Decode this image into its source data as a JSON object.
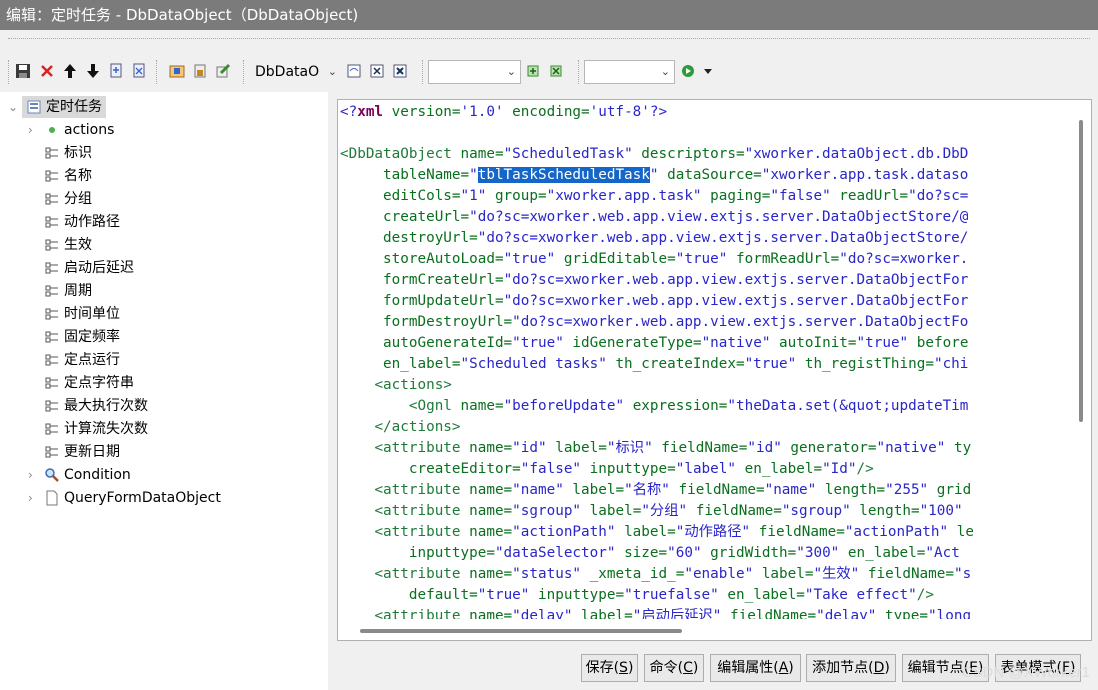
{
  "window": {
    "title": "编辑：定时任务 - DbDataObject（DbDataObject)"
  },
  "toolbar": {
    "combo1_value": "DbDataO",
    "combo2_value": "",
    "combo3_value": "",
    "icons": [
      "save-icon",
      "delete-icon",
      "move-up-icon",
      "move-down-icon",
      "export-icon",
      "import-icon",
      "open-icon",
      "lock-icon",
      "edit-icon",
      "doc-icon",
      "close-doc-icon",
      "close-all-icon",
      "add-icon",
      "remove-icon",
      "run-icon",
      "dropdown-icon"
    ]
  },
  "tree": {
    "root": {
      "label": "定时任务",
      "icon": "dataobject-icon"
    },
    "items": [
      {
        "label": "actions",
        "icon": "dot-icon",
        "expandable": true
      },
      {
        "label": "标识",
        "icon": "attribute-icon"
      },
      {
        "label": "名称",
        "icon": "attribute-icon"
      },
      {
        "label": "分组",
        "icon": "attribute-icon"
      },
      {
        "label": "动作路径",
        "icon": "attribute-icon"
      },
      {
        "label": "生效",
        "icon": "attribute-icon"
      },
      {
        "label": "启动后延迟",
        "icon": "attribute-icon"
      },
      {
        "label": "周期",
        "icon": "attribute-icon"
      },
      {
        "label": "时间单位",
        "icon": "attribute-icon"
      },
      {
        "label": "固定频率",
        "icon": "attribute-icon"
      },
      {
        "label": "定点运行",
        "icon": "attribute-icon"
      },
      {
        "label": "定点字符串",
        "icon": "attribute-icon"
      },
      {
        "label": "最大执行次数",
        "icon": "attribute-icon"
      },
      {
        "label": "计算流失次数",
        "icon": "attribute-icon"
      },
      {
        "label": "更新日期",
        "icon": "attribute-icon"
      },
      {
        "label": "Condition",
        "icon": "search-icon",
        "expandable": true
      },
      {
        "label": "QueryFormDataObject",
        "icon": "document-icon",
        "expandable": true
      }
    ]
  },
  "editor": {
    "lines": [
      {
        "indent": "",
        "parts": [
          [
            "kw",
            "<?"
          ],
          [
            "kwb",
            "xml"
          ],
          [
            "at",
            " version="
          ],
          [
            "val",
            "'1.0'"
          ],
          [
            "at",
            " encoding="
          ],
          [
            "val",
            "'utf-8'"
          ],
          [
            "kw",
            "?>"
          ]
        ]
      },
      {
        "indent": "",
        "parts": []
      },
      {
        "indent": "",
        "parts": [
          [
            "tag",
            "<DbDataObject"
          ],
          [
            "at",
            " name="
          ],
          [
            "val",
            "\"ScheduledTask\""
          ],
          [
            "at",
            " descriptors="
          ],
          [
            "val",
            "\"xworker.dataObject.db.DbD"
          ]
        ]
      },
      {
        "indent": "     ",
        "parts": [
          [
            "at",
            "tableName="
          ],
          [
            "val",
            "\""
          ],
          [
            "hl",
            "tblTaskScheduledTask"
          ],
          [
            "val",
            "\""
          ],
          [
            "at",
            " dataSource="
          ],
          [
            "val",
            "\"xworker.app.task.dataso"
          ]
        ]
      },
      {
        "indent": "     ",
        "parts": [
          [
            "at",
            "editCols="
          ],
          [
            "val",
            "\"1\""
          ],
          [
            "at",
            " group="
          ],
          [
            "val",
            "\"xworker.app.task\""
          ],
          [
            "at",
            " paging="
          ],
          [
            "val",
            "\"false\""
          ],
          [
            "at",
            " readUrl="
          ],
          [
            "val",
            "\"do?sc="
          ]
        ]
      },
      {
        "indent": "     ",
        "parts": [
          [
            "at",
            "createUrl="
          ],
          [
            "val",
            "\"do?sc=xworker.web.app.view.extjs.server.DataObjectStore/@"
          ]
        ]
      },
      {
        "indent": "     ",
        "parts": [
          [
            "at",
            "destroyUrl="
          ],
          [
            "val",
            "\"do?sc=xworker.web.app.view.extjs.server.DataObjectStore/"
          ]
        ]
      },
      {
        "indent": "     ",
        "parts": [
          [
            "at",
            "storeAutoLoad="
          ],
          [
            "val",
            "\"true\""
          ],
          [
            "at",
            " gridEditable="
          ],
          [
            "val",
            "\"true\""
          ],
          [
            "at",
            " formReadUrl="
          ],
          [
            "val",
            "\"do?sc=xworker."
          ]
        ]
      },
      {
        "indent": "     ",
        "parts": [
          [
            "at",
            "formCreateUrl="
          ],
          [
            "val",
            "\"do?sc=xworker.web.app.view.extjs.server.DataObjectFor"
          ]
        ]
      },
      {
        "indent": "     ",
        "parts": [
          [
            "at",
            "formUpdateUrl="
          ],
          [
            "val",
            "\"do?sc=xworker.web.app.view.extjs.server.DataObjectFor"
          ]
        ]
      },
      {
        "indent": "     ",
        "parts": [
          [
            "at",
            "formDestroyUrl="
          ],
          [
            "val",
            "\"do?sc=xworker.web.app.view.extjs.server.DataObjectFo"
          ]
        ]
      },
      {
        "indent": "     ",
        "parts": [
          [
            "at",
            "autoGenerateId="
          ],
          [
            "val",
            "\"true\""
          ],
          [
            "at",
            " idGenerateType="
          ],
          [
            "val",
            "\"native\""
          ],
          [
            "at",
            " autoInit="
          ],
          [
            "val",
            "\"true\""
          ],
          [
            "at",
            " before"
          ]
        ]
      },
      {
        "indent": "     ",
        "parts": [
          [
            "at",
            "en_label="
          ],
          [
            "val",
            "\"Scheduled tasks\""
          ],
          [
            "at",
            " th_createIndex="
          ],
          [
            "val",
            "\"true\""
          ],
          [
            "at",
            " th_registThing="
          ],
          [
            "val",
            "\"chi"
          ]
        ]
      },
      {
        "indent": "    ",
        "parts": [
          [
            "tag",
            "<actions>"
          ]
        ]
      },
      {
        "indent": "        ",
        "parts": [
          [
            "tag",
            "<Ognl"
          ],
          [
            "at",
            " name="
          ],
          [
            "val",
            "\"beforeUpdate\""
          ],
          [
            "at",
            " expression="
          ],
          [
            "val",
            "\"theData.set(&quot;updateTim"
          ]
        ]
      },
      {
        "indent": "    ",
        "parts": [
          [
            "tag",
            "</actions>"
          ]
        ]
      },
      {
        "indent": "    ",
        "parts": [
          [
            "tag",
            "<attribute"
          ],
          [
            "at",
            " name="
          ],
          [
            "val",
            "\"id\""
          ],
          [
            "at",
            " label="
          ],
          [
            "val",
            "\"标识\""
          ],
          [
            "at",
            " fieldName="
          ],
          [
            "val",
            "\"id\""
          ],
          [
            "at",
            " generator="
          ],
          [
            "val",
            "\"native\""
          ],
          [
            "at",
            " ty"
          ]
        ]
      },
      {
        "indent": "        ",
        "parts": [
          [
            "at",
            "createEditor="
          ],
          [
            "val",
            "\"false\""
          ],
          [
            "at",
            " inputtype="
          ],
          [
            "val",
            "\"label\""
          ],
          [
            "at",
            " en_label="
          ],
          [
            "val",
            "\"Id\""
          ],
          [
            "tag",
            "/>"
          ]
        ]
      },
      {
        "indent": "    ",
        "parts": [
          [
            "tag",
            "<attribute"
          ],
          [
            "at",
            " name="
          ],
          [
            "val",
            "\"name\""
          ],
          [
            "at",
            " label="
          ],
          [
            "val",
            "\"名称\""
          ],
          [
            "at",
            " fieldName="
          ],
          [
            "val",
            "\"name\""
          ],
          [
            "at",
            " length="
          ],
          [
            "val",
            "\"255\""
          ],
          [
            "at",
            " grid"
          ]
        ]
      },
      {
        "indent": "    ",
        "parts": [
          [
            "tag",
            "<attribute"
          ],
          [
            "at",
            " name="
          ],
          [
            "val",
            "\"sgroup\""
          ],
          [
            "at",
            " label="
          ],
          [
            "val",
            "\"分组\""
          ],
          [
            "at",
            " fieldName="
          ],
          [
            "val",
            "\"sgroup\""
          ],
          [
            "at",
            " length="
          ],
          [
            "val",
            "\"100\""
          ]
        ]
      },
      {
        "indent": "    ",
        "parts": [
          [
            "tag",
            "<attribute"
          ],
          [
            "at",
            " name="
          ],
          [
            "val",
            "\"actionPath\""
          ],
          [
            "at",
            " label="
          ],
          [
            "val",
            "\"动作路径\""
          ],
          [
            "at",
            " fieldName="
          ],
          [
            "val",
            "\"actionPath\""
          ],
          [
            "at",
            " le"
          ]
        ]
      },
      {
        "indent": "        ",
        "parts": [
          [
            "at",
            "inputtype="
          ],
          [
            "val",
            "\"dataSelector\""
          ],
          [
            "at",
            " size="
          ],
          [
            "val",
            "\"60\""
          ],
          [
            "at",
            " gridWidth="
          ],
          [
            "val",
            "\"300\""
          ],
          [
            "at",
            " en_label="
          ],
          [
            "val",
            "\"Act"
          ]
        ]
      },
      {
        "indent": "    ",
        "parts": [
          [
            "tag",
            "<attribute"
          ],
          [
            "at",
            " name="
          ],
          [
            "val",
            "\"status\""
          ],
          [
            "at",
            " _xmeta_id_="
          ],
          [
            "val",
            "\"enable\""
          ],
          [
            "at",
            " label="
          ],
          [
            "val",
            "\"生效\""
          ],
          [
            "at",
            " fieldName="
          ],
          [
            "val",
            "\"s"
          ]
        ]
      },
      {
        "indent": "        ",
        "parts": [
          [
            "at",
            "default="
          ],
          [
            "val",
            "\"true\""
          ],
          [
            "at",
            " inputtype="
          ],
          [
            "val",
            "\"truefalse\""
          ],
          [
            "at",
            " en_label="
          ],
          [
            "val",
            "\"Take effect\""
          ],
          [
            "tag",
            "/>"
          ]
        ]
      },
      {
        "indent": "    ",
        "parts": [
          [
            "tag",
            "<attribute"
          ],
          [
            "at",
            " name="
          ],
          [
            "val",
            "\"delay\""
          ],
          [
            "at",
            " label="
          ],
          [
            "val",
            "\"启动后延迟\""
          ],
          [
            "at",
            " fieldName="
          ],
          [
            "val",
            "\"delay\""
          ],
          [
            "at",
            " type="
          ],
          [
            "val",
            "\"long"
          ]
        ]
      }
    ]
  },
  "buttons": [
    {
      "label": "保存(",
      "key": "S",
      "tail": ")"
    },
    {
      "label": "命令(",
      "key": "C",
      "tail": ")"
    },
    {
      "label": "编辑属性(",
      "key": "A",
      "tail": ")"
    },
    {
      "label": "添加节点(",
      "key": "D",
      "tail": ")"
    },
    {
      "label": "编辑节点(",
      "key": "E",
      "tail": ")"
    },
    {
      "label": "表单模式(",
      "key": "F",
      "tail": ")"
    }
  ],
  "watermark": "CSDN @XWorker1"
}
